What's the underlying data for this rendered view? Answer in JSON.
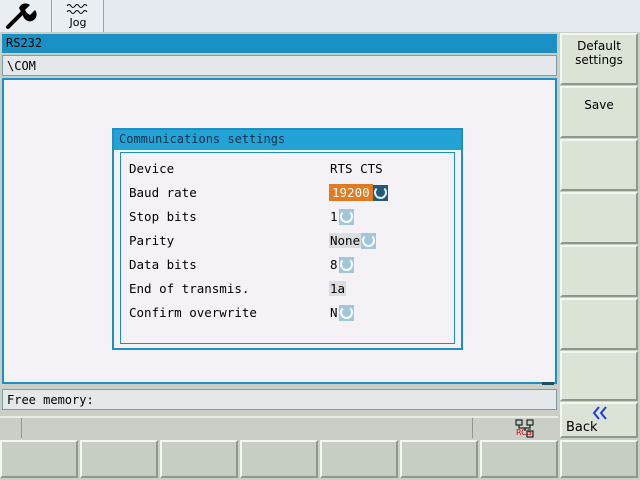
{
  "topbar": {
    "jog_label": "Jog"
  },
  "window": {
    "title": "RS232",
    "path": "\\COM",
    "status": "Free memory:"
  },
  "dialog": {
    "title": "Communications settings",
    "rows": [
      {
        "label": "Device",
        "value": "RTS CTS"
      },
      {
        "label": "Baud rate",
        "value": "19200"
      },
      {
        "label": "Stop bits",
        "value": "1"
      },
      {
        "label": "Parity",
        "value": "None"
      },
      {
        "label": "Data bits",
        "value": "8"
      },
      {
        "label": "End of transmis.",
        "value": "1a"
      },
      {
        "label": "Confirm overwrite",
        "value": "N"
      }
    ]
  },
  "softkeys": {
    "default_line1": "Default",
    "default_line2": "settings",
    "save": "Save",
    "back": "Back"
  },
  "icons": {
    "wrench": "wrench-icon",
    "jog": "jog-wave-icon",
    "cycle": "cycle-toggle-icon",
    "rcs": "rcs-network-icon",
    "back": "double-chevron-left-icon"
  },
  "rcs_label": "RCS",
  "colors": {
    "accent": "#1a91c4",
    "selection": "#e07b22",
    "back_arrow": "#1a3fd0"
  }
}
